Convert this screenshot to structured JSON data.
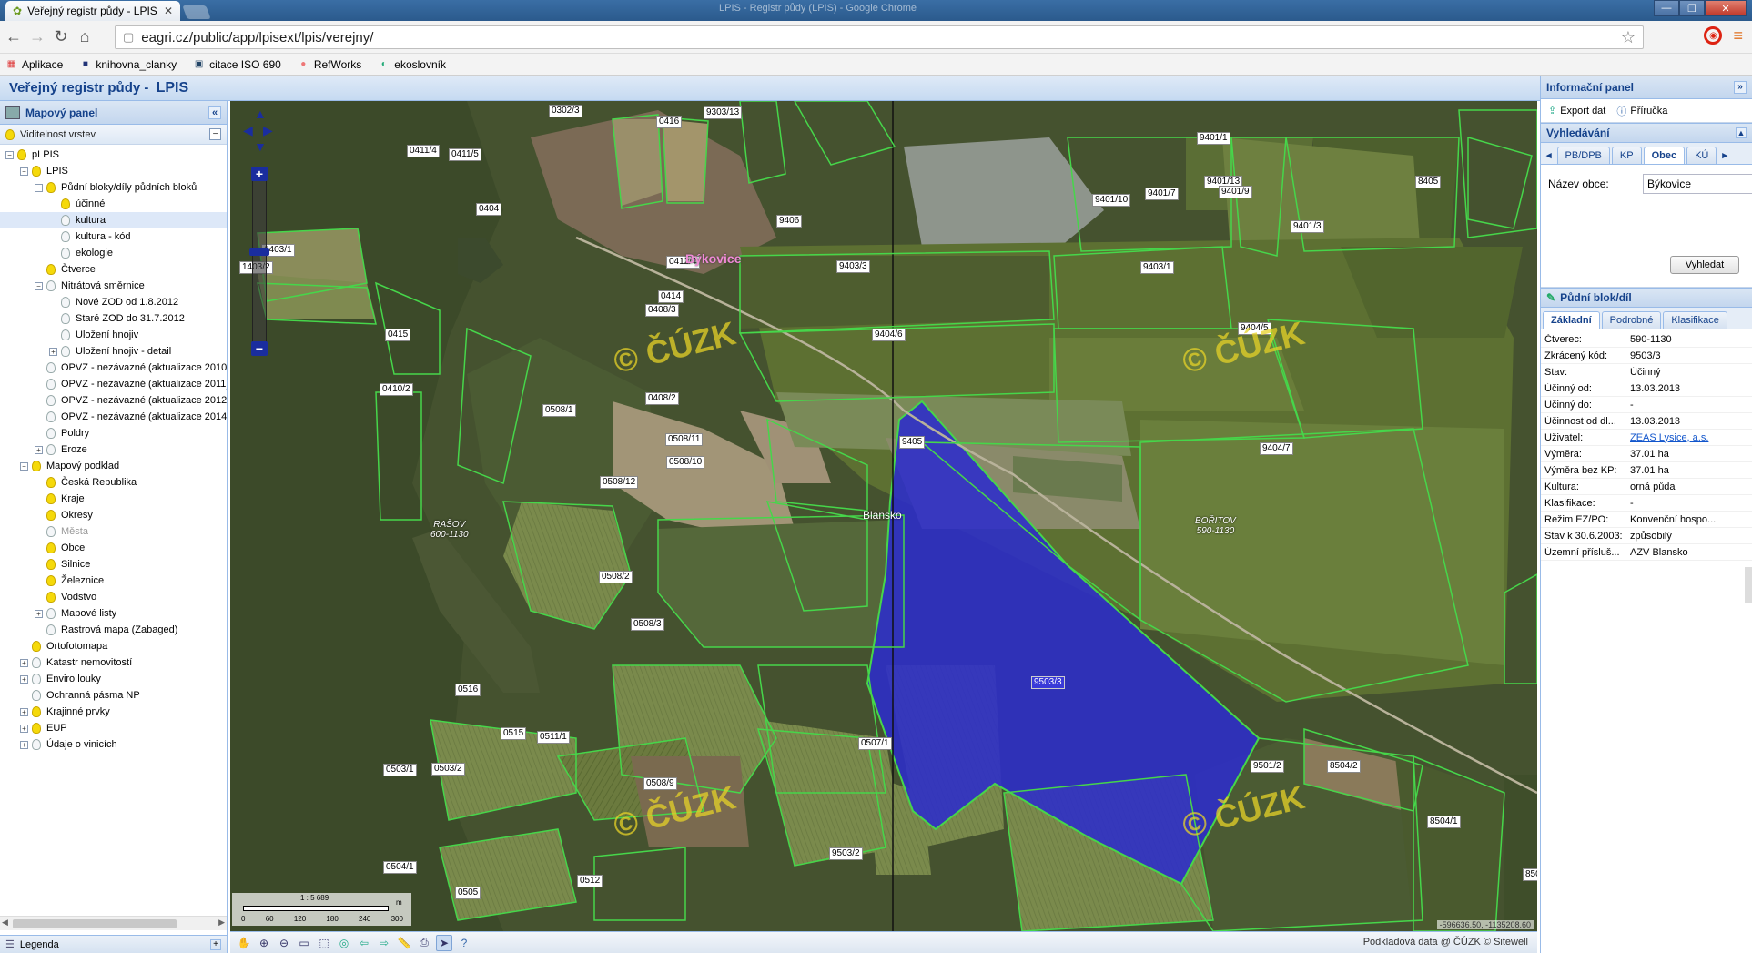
{
  "browser": {
    "tab_title": "Veřejný registr půdy - LPIS",
    "window_title": "LPIS - Registr půdy (LPIS) - Google Chrome",
    "url": "eagri.cz/public/app/lpisext/lpis/verejny/",
    "bookmarks": [
      "Aplikace",
      "knihovna_clanky",
      "citace ISO 690",
      "RefWorks",
      "ekoslovník"
    ]
  },
  "app": {
    "title_prefix": "Veřejný registr půdy - ",
    "title_brand": "LPIS"
  },
  "left_panel": {
    "title": "Mapový panel",
    "visibility_header": "Viditelnost vrstev",
    "tree": [
      {
        "label": "pLPIS",
        "level": 0,
        "exp": "-",
        "on": true
      },
      {
        "label": "LPIS",
        "level": 1,
        "exp": "-",
        "on": true
      },
      {
        "label": "Půdní bloky/díly půdních bloků",
        "level": 2,
        "exp": "-",
        "on": true
      },
      {
        "label": "účinné",
        "level": 3,
        "exp": "",
        "on": true
      },
      {
        "label": "kultura",
        "level": 3,
        "exp": "",
        "on": false,
        "sel": true
      },
      {
        "label": "kultura - kód",
        "level": 3,
        "exp": "",
        "on": false
      },
      {
        "label": "ekologie",
        "level": 3,
        "exp": "",
        "on": false
      },
      {
        "label": "Čtverce",
        "level": 2,
        "exp": "",
        "on": true
      },
      {
        "label": "Nitrátová směrnice",
        "level": 2,
        "exp": "-",
        "on": false
      },
      {
        "label": "Nové ZOD od 1.8.2012",
        "level": 3,
        "exp": "",
        "on": false
      },
      {
        "label": "Staré ZOD do 31.7.2012",
        "level": 3,
        "exp": "",
        "on": false
      },
      {
        "label": "Uložení hnojiv",
        "level": 3,
        "exp": "",
        "on": false
      },
      {
        "label": "Uložení hnojiv - detail",
        "level": 3,
        "exp": "+",
        "on": false
      },
      {
        "label": "OPVZ - nezávazné (aktualizace 2010)",
        "level": 2,
        "exp": "",
        "on": false
      },
      {
        "label": "OPVZ - nezávazné (aktualizace 2011)",
        "level": 2,
        "exp": "",
        "on": false
      },
      {
        "label": "OPVZ - nezávazné (aktualizace 2012)",
        "level": 2,
        "exp": "",
        "on": false
      },
      {
        "label": "OPVZ - nezávazné (aktualizace 2014)",
        "level": 2,
        "exp": "",
        "on": false
      },
      {
        "label": "Poldry",
        "level": 2,
        "exp": "",
        "on": false
      },
      {
        "label": "Eroze",
        "level": 2,
        "exp": "+",
        "on": false
      },
      {
        "label": "Mapový podklad",
        "level": 1,
        "exp": "-",
        "on": true
      },
      {
        "label": "Česká Republika",
        "level": 2,
        "exp": "",
        "on": true
      },
      {
        "label": "Kraje",
        "level": 2,
        "exp": "",
        "on": true
      },
      {
        "label": "Okresy",
        "level": 2,
        "exp": "",
        "on": true
      },
      {
        "label": "Města",
        "level": 2,
        "exp": "",
        "on": false,
        "dim": true
      },
      {
        "label": "Obce",
        "level": 2,
        "exp": "",
        "on": true
      },
      {
        "label": "Silnice",
        "level": 2,
        "exp": "",
        "on": true
      },
      {
        "label": "Železnice",
        "level": 2,
        "exp": "",
        "on": true
      },
      {
        "label": "Vodstvo",
        "level": 2,
        "exp": "",
        "on": true
      },
      {
        "label": "Mapové listy",
        "level": 2,
        "exp": "+",
        "on": false
      },
      {
        "label": "Rastrová mapa (Zabaged)",
        "level": 2,
        "exp": "",
        "on": false
      },
      {
        "label": "Ortofotomapa",
        "level": 1,
        "exp": "",
        "on": true
      },
      {
        "label": "Katastr nemovitostí",
        "level": 1,
        "exp": "+",
        "on": false
      },
      {
        "label": "Enviro louky",
        "level": 1,
        "exp": "+",
        "on": false
      },
      {
        "label": "Ochranná pásma NP",
        "level": 1,
        "exp": "",
        "on": false
      },
      {
        "label": "Krajinné prvky",
        "level": 1,
        "exp": "+",
        "on": true
      },
      {
        "label": "EUP",
        "level": 1,
        "exp": "+",
        "on": true
      },
      {
        "label": "Údaje o vinicích",
        "level": 1,
        "exp": "+",
        "on": false
      }
    ],
    "legend_label": "Legenda"
  },
  "map": {
    "town_name": "Býkovice",
    "station_name": "Blansko",
    "watermark": "© ČÚZK",
    "place_names": [
      {
        "name": "RAŠOV",
        "code": "600-1130"
      },
      {
        "name": "BOŘITOV",
        "code": "590-1130"
      }
    ],
    "parcels": [
      "0302/3",
      "0416",
      "9303/13",
      "9401/1",
      "0411/4",
      "0411/5",
      "9401/13",
      "8405",
      "9401/10",
      "9401/7",
      "9401/9",
      "9401/3",
      "0404",
      "9406",
      "1403/1",
      "1403/2",
      "0412/4",
      "9403/3",
      "9403/1",
      "0414",
      "0415",
      "0408/3",
      "9404/6",
      "9404/5",
      "0410/2",
      "0408/2",
      "0508/1",
      "0508/11",
      "9405",
      "9404/7",
      "0508/10",
      "0508/12",
      "0508/2",
      "0508/3",
      "9503/3",
      "0516",
      "0515",
      "0511/1",
      "0507/1",
      "9501/2",
      "8504/2",
      "0503/1",
      "0503/2",
      "0508/9",
      "8504/1",
      "9503/2",
      "0504/1",
      "0505",
      "0512",
      "8503"
    ],
    "selected_parcel": "9503/3",
    "scale_ratio": "1 : 5 689",
    "scale_unit": "m",
    "scale_ticks": [
      "0",
      "60",
      "120",
      "180",
      "240",
      "300"
    ],
    "coordinates": "-596636.50, -1135208.60",
    "attribution": "Podkladová data @ ČÚZK    © Sitewell",
    "colors": {
      "selected_fill": "#2c2ccb",
      "parcel_border": "#46d64a",
      "label_bg": "#ffffff"
    }
  },
  "right_panel": {
    "title": "Informační panel",
    "tools": [
      "Export dat",
      "Příručka"
    ],
    "search": {
      "title": "Vyhledávání",
      "tabs": [
        "PB/DPB",
        "KP",
        "Obec",
        "KÚ"
      ],
      "active_tab": "Obec",
      "field_label": "Název obce:",
      "field_value": "Býkovice",
      "button": "Vyhledat"
    },
    "detail": {
      "title": "Půdní blok/díl",
      "tabs": [
        "Základní",
        "Podrobné",
        "Klasifikace"
      ],
      "active_tab": "Základní",
      "rows": [
        {
          "k": "Čtverec:",
          "v": "590-1130"
        },
        {
          "k": "Zkrácený kód:",
          "v": "9503/3"
        },
        {
          "k": "Stav:",
          "v": "Účinný"
        },
        {
          "k": "Účinný od:",
          "v": "13.03.2013"
        },
        {
          "k": "Účinný do:",
          "v": "-"
        },
        {
          "k": "Účinnost od dl...",
          "v": "13.03.2013"
        },
        {
          "k": "Uživatel:",
          "v": "ZEAS Lysice, a.s.",
          "link": true
        },
        {
          "k": "Výměra:",
          "v": "37.01 ha"
        },
        {
          "k": "Výměra bez KP:",
          "v": "37.01 ha"
        },
        {
          "k": "Kultura:",
          "v": "orná půda"
        },
        {
          "k": "Klasifikace:",
          "v": "-"
        },
        {
          "k": "Režim EZ/PO:",
          "v": "Konvenční hospo..."
        },
        {
          "k": "Stav k 30.6.2003:",
          "v": "způsobilý"
        },
        {
          "k": "Územní přísluš...",
          "v": "AZV Blansko"
        }
      ]
    }
  }
}
